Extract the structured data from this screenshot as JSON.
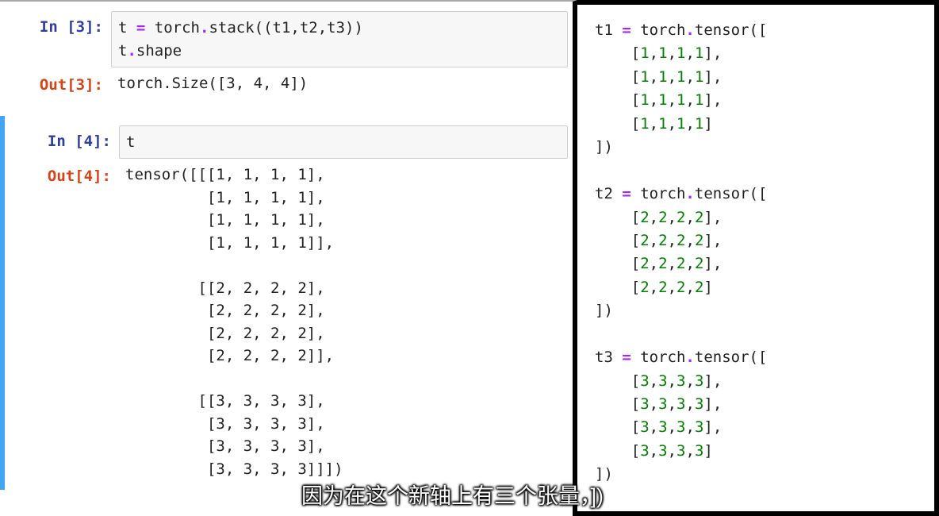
{
  "prompts": {
    "in3": "In [3]:",
    "out3": "Out[3]:",
    "in4": "In [4]:",
    "out4": "Out[4]:"
  },
  "cells": {
    "in3_line1": "t = torch.stack((t1,t2,t3))",
    "in3_line2": "t.shape",
    "out3_text": "torch.Size([3, 4, 4])",
    "in4_text": "t",
    "out4_text": "tensor([[[1, 1, 1, 1],\n         [1, 1, 1, 1],\n         [1, 1, 1, 1],\n         [1, 1, 1, 1]],\n\n        [[2, 2, 2, 2],\n         [2, 2, 2, 2],\n         [2, 2, 2, 2],\n         [2, 2, 2, 2]],\n\n        [[3, 3, 3, 3],\n         [3, 3, 3, 3],\n         [3, 3, 3, 3],\n         [3, 3, 3, 3]]])"
  },
  "right": {
    "t1_header": "t1 = torch.tensor([",
    "t1_rows": [
      "    [1,1,1,1],",
      "    [1,1,1,1],",
      "    [1,1,1,1],",
      "    [1,1,1,1]"
    ],
    "close": "])",
    "t2_header": "t2 = torch.tensor([",
    "t2_rows": [
      "    [2,2,2,2],",
      "    [2,2,2,2],",
      "    [2,2,2,2],",
      "    [2,2,2,2]"
    ],
    "t3_header": "t3 = torch.tensor([",
    "t3_rows": [
      "    [3,3,3,3],",
      "    [3,3,3,3],",
      "    [3,3,3,3],",
      "    [3,3,3,3]"
    ]
  },
  "caption": "因为在这个新轴上有三个张量，])"
}
